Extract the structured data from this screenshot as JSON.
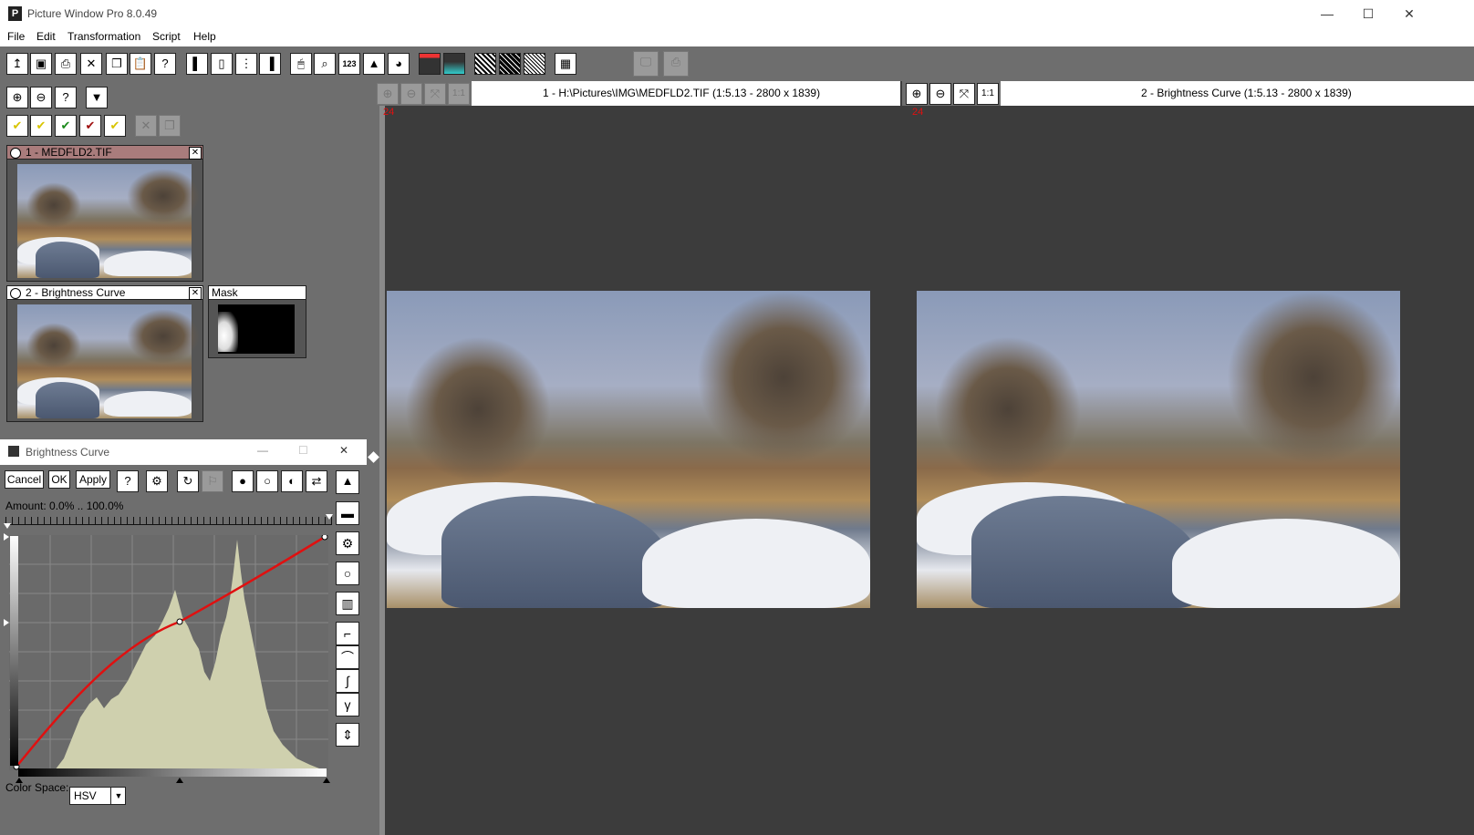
{
  "window": {
    "title": "Picture Window Pro 8.0.49",
    "app_icon": "P",
    "minimize": "—",
    "maximize": "☐",
    "close": "✕"
  },
  "menu": [
    "File",
    "Edit",
    "Transformation",
    "Script",
    "Help"
  ],
  "thumbnails": [
    {
      "title": "1 - MEDFLD2.TIF",
      "close": "✕"
    },
    {
      "title": "2 - Brightness Curve",
      "close": "✕"
    }
  ],
  "mask": {
    "title": "Mask"
  },
  "viewers": [
    {
      "title": "1 - H:\\Pictures\\IMG\\MEDFLD2.TIF (1:5.13 - 2800 x 1839)",
      "number": "24",
      "one_to_one": "1:1"
    },
    {
      "title": "2 - Brightness Curve (1:5.13 - 2800 x 1839)",
      "number": "24",
      "one_to_one": "1:1"
    }
  ],
  "dialog": {
    "title": "Brightness Curve",
    "cancel": "Cancel",
    "ok": "OK",
    "apply": "Apply",
    "help": "?",
    "amount_label": "Amount: 0.0% .. 100.0%",
    "color_space_label": "Color Space:",
    "color_space_value": "HSV",
    "minimize": "—",
    "maximize": "☐",
    "close": "✕"
  },
  "colors": {
    "curve": "#e01010",
    "histogram": "#cfd0ae",
    "thumb_header_active": "#a97c7c"
  }
}
